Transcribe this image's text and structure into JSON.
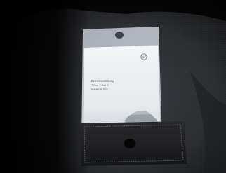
{
  "photo": {
    "subject": "car owner's manual in a clear sleeve with leather pocket on fabric seat",
    "manual": {
      "title": "Betriebsanleitung",
      "model": "T-Roc, T-Roc R",
      "edition": "Ausgabe 06.2018",
      "brand_logo": "vw-logo-icon"
    },
    "colors": {
      "background": "#000000",
      "fabric": "#2d3034",
      "sleeve": "#c8ccd2",
      "manual_page": "#eceef1",
      "leather": "#1e1f21",
      "stitching": "#6a6c6e"
    }
  }
}
